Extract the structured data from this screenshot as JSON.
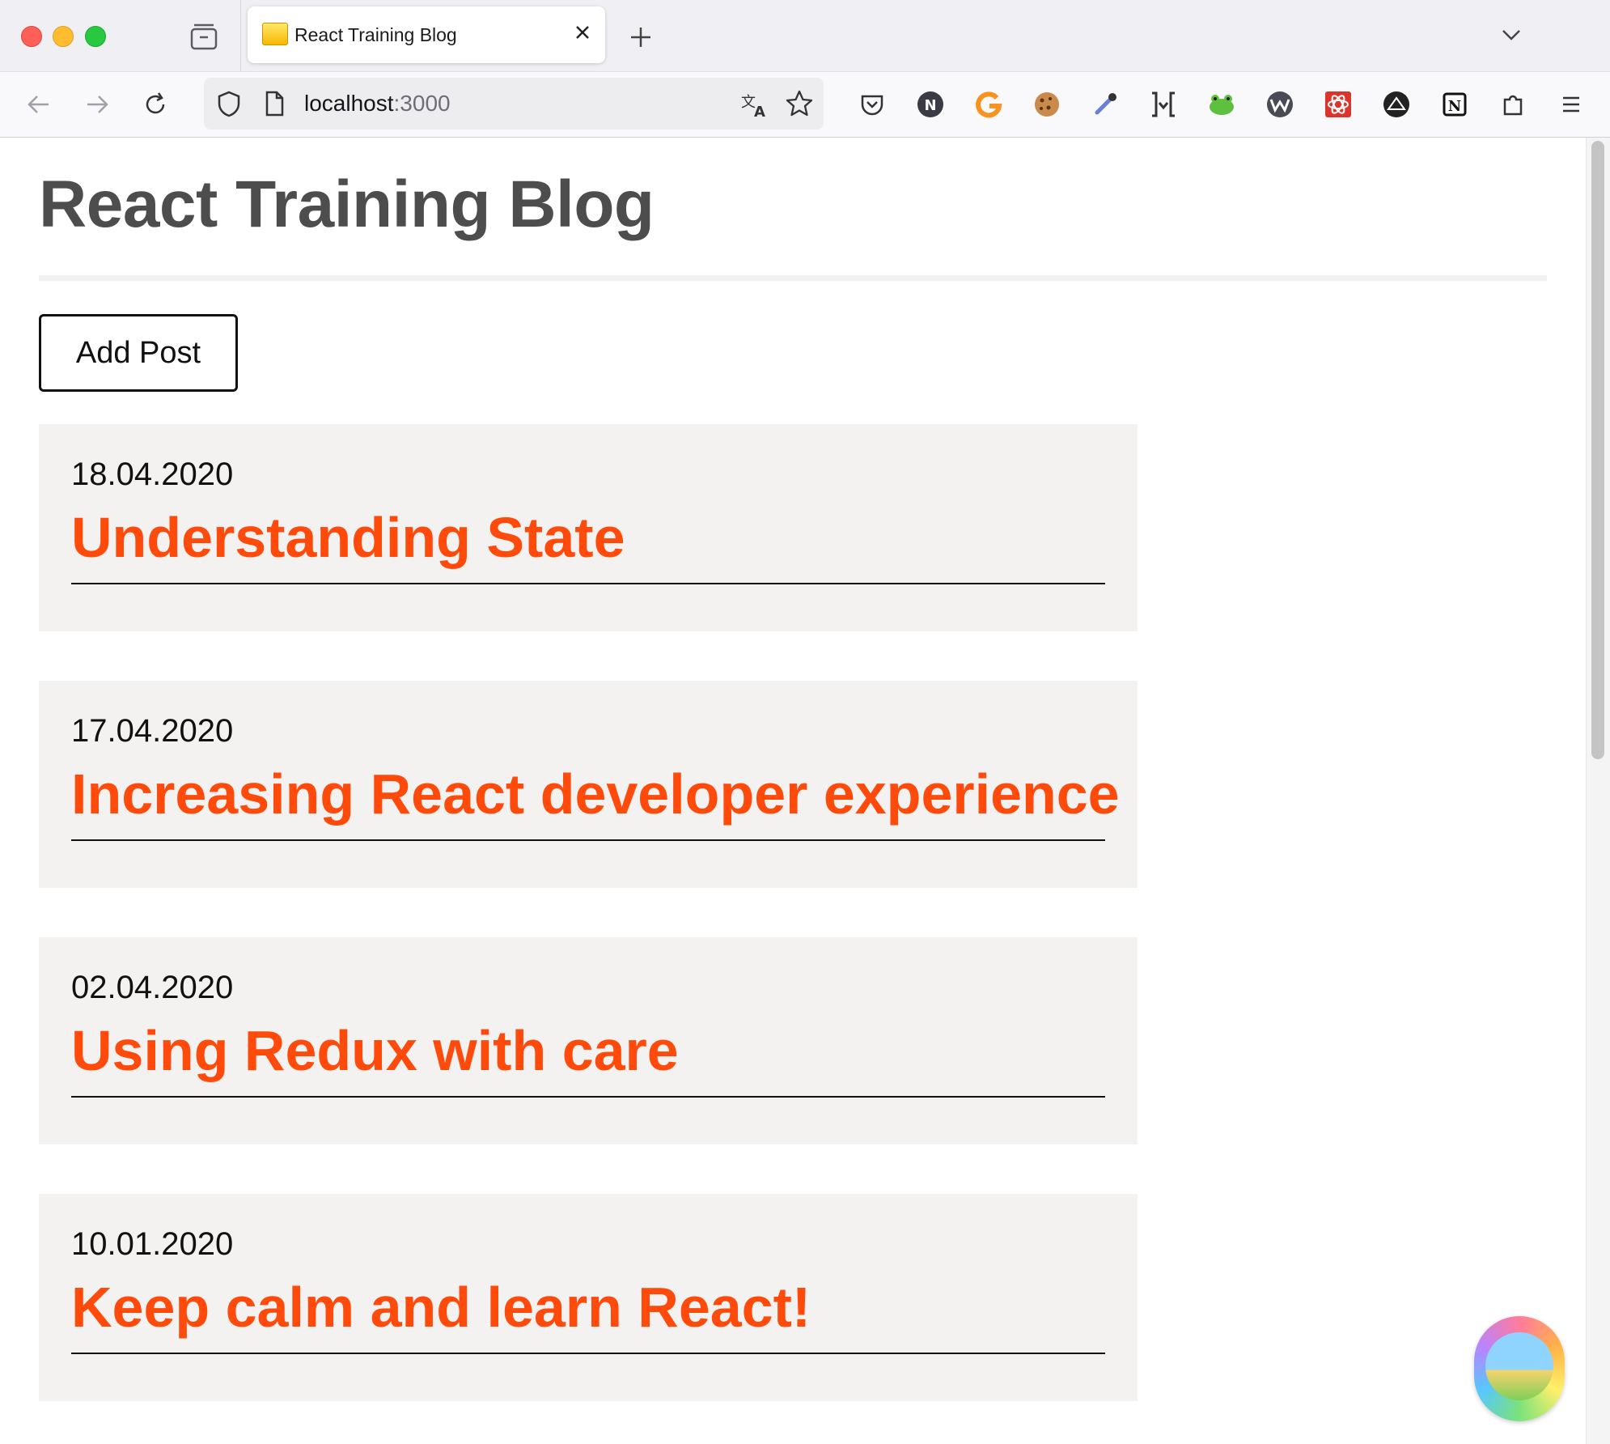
{
  "browser": {
    "tab": {
      "title": "React Training Blog"
    },
    "url": {
      "host": "localhost",
      "port": ":3000"
    },
    "extensions": [
      "pocket-icon",
      "n-icon",
      "g-icon",
      "cookie-icon",
      "eyedropper-icon",
      "bracket-icon",
      "frog-icon",
      "w-icon",
      "react-devtools-icon",
      "tent-icon",
      "notion-icon",
      "puzzle-icon",
      "menu-icon"
    ]
  },
  "blog": {
    "title": "React Training Blog",
    "add_post_label": "Add Post",
    "posts": [
      {
        "date": "18.04.2020",
        "title": "Understanding State"
      },
      {
        "date": "17.04.2020",
        "title": "Increasing React developer experience"
      },
      {
        "date": "02.04.2020",
        "title": "Using Redux with care"
      },
      {
        "date": "10.01.2020",
        "title": "Keep calm and learn React!"
      }
    ]
  },
  "colors": {
    "accent": "#fe4a0b",
    "card": "#f3f2f1",
    "heading": "#4d4d4d"
  }
}
